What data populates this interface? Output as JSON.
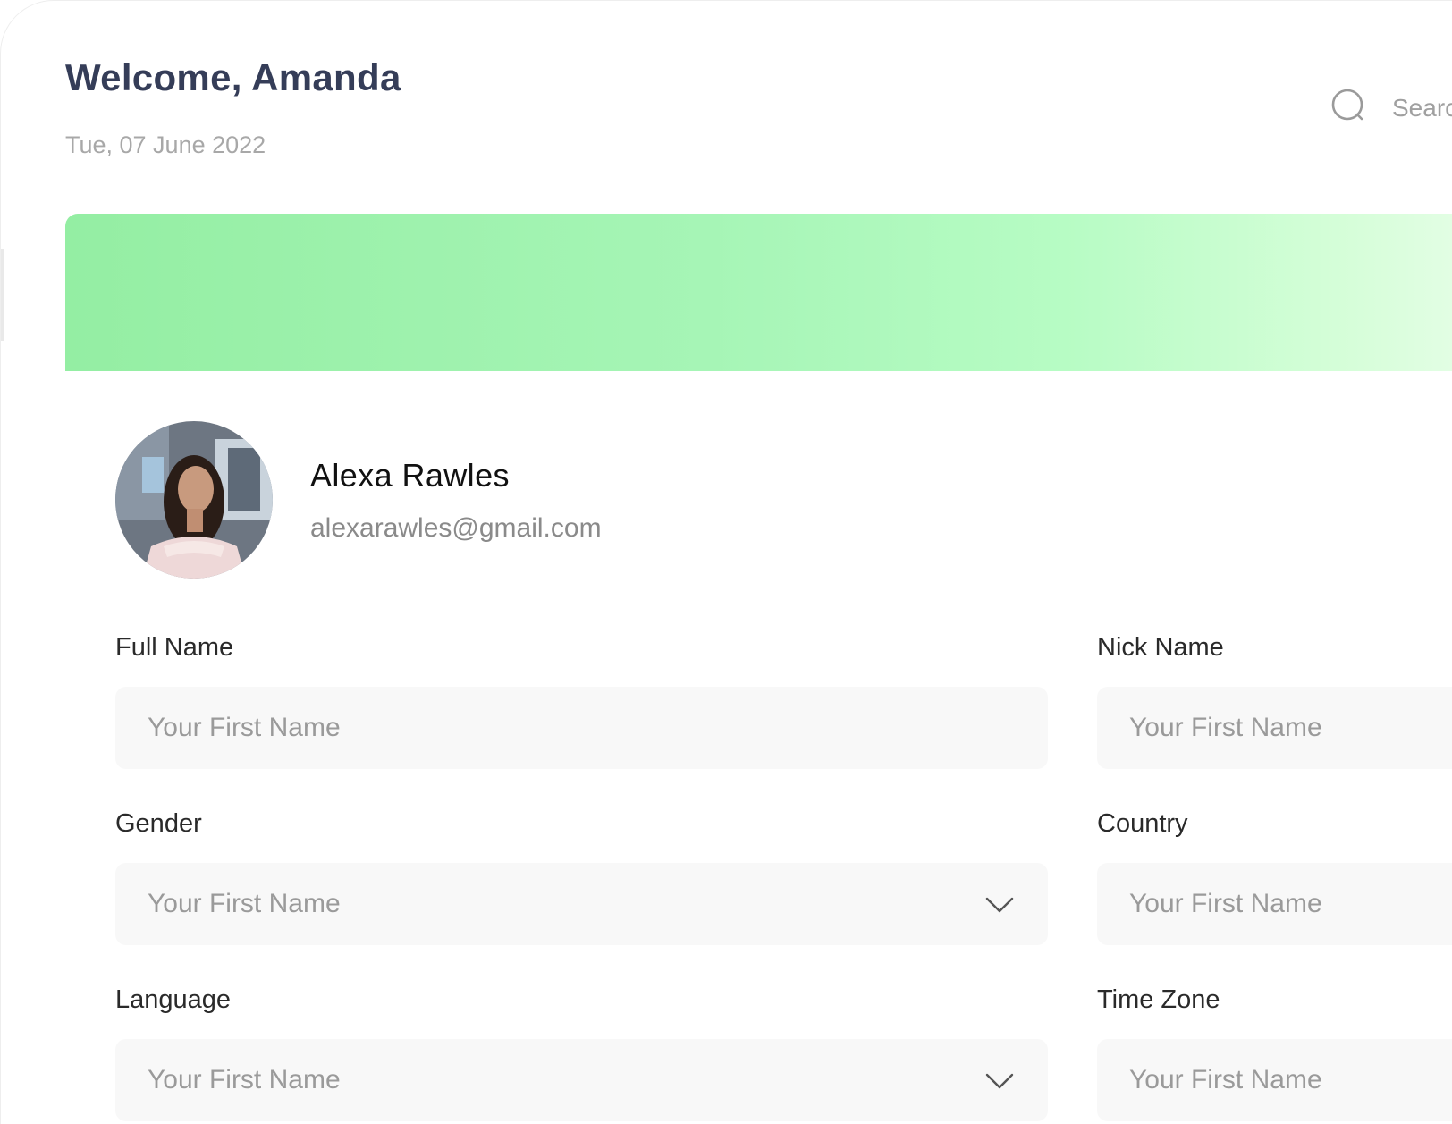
{
  "header": {
    "greeting": "Welcome, Amanda",
    "date": "Tue, 07 June 2022",
    "search": {
      "placeholder": "Searc",
      "icon": "search-icon"
    }
  },
  "banner": {
    "colors": [
      "#94eea3",
      "#b7fcc4",
      "#e7fee8"
    ]
  },
  "profile": {
    "avatar_icon": "avatar-photo",
    "name": "Alexa Rawles",
    "email": "alexarawles@gmail.com"
  },
  "form": {
    "full_name": {
      "label": "Full Name",
      "placeholder": "Your First Name"
    },
    "nick_name": {
      "label": "Nick Name",
      "placeholder": "Your First Name"
    },
    "gender": {
      "label": "Gender",
      "placeholder": "Your First Name",
      "icon": "chevron-down-icon"
    },
    "country": {
      "label": "Country",
      "placeholder": "Your First Name"
    },
    "language": {
      "label": "Language",
      "placeholder": "Your First Name",
      "icon": "chevron-down-icon"
    },
    "time_zone": {
      "label": "Time Zone",
      "placeholder": "Your First Name"
    }
  },
  "colors": {
    "heading": "#353d58",
    "muted": "#a8a8a8",
    "field_bg": "#f8f8f8",
    "accent_green": "#94eea3"
  }
}
